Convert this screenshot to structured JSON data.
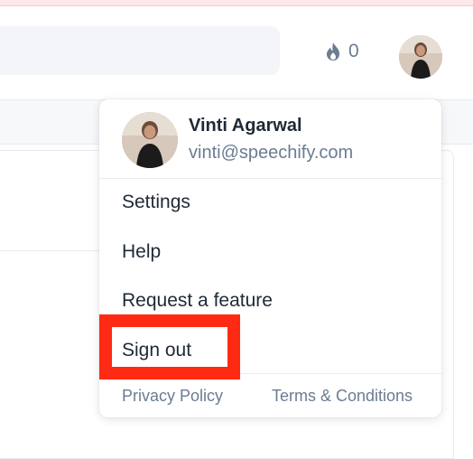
{
  "header": {
    "streak_count": "0",
    "streak_icon": "flame-icon"
  },
  "user_menu": {
    "user_name": "Vinti Agarwal",
    "user_email": "vinti@speechify.com",
    "items": [
      {
        "label": "Settings"
      },
      {
        "label": "Help"
      },
      {
        "label": "Request a feature"
      },
      {
        "label": "Sign out"
      }
    ],
    "footer": {
      "privacy_label": "Privacy Policy",
      "terms_label": "Terms & Conditions"
    }
  },
  "annotation": {
    "highlight_color": "#ff2a14"
  }
}
